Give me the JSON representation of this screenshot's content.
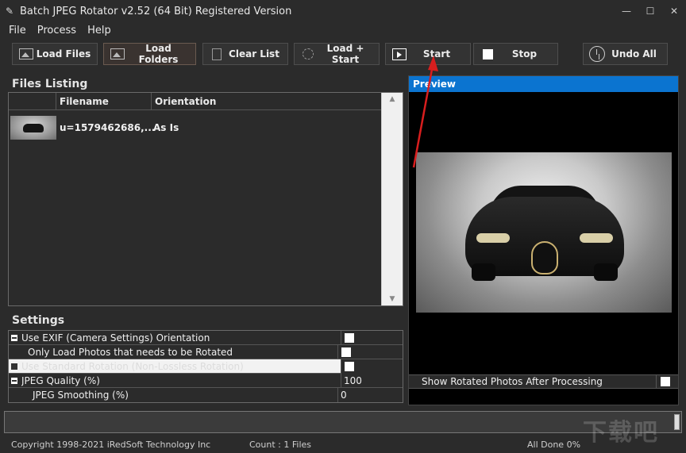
{
  "window": {
    "title": "Batch JPEG Rotator v2.52 (64 Bit) Registered Version",
    "app_icon": "app-logo-icon",
    "controls": [
      "minimize-icon",
      "maximize-icon",
      "close-icon"
    ]
  },
  "menu": [
    "File",
    "Process",
    "Help"
  ],
  "toolbar": {
    "load_files": "Load Files",
    "load_folders": "Load Folders",
    "clear_list": "Clear List",
    "load_start": "Load + Start",
    "start": "Start",
    "stop": "Stop",
    "undo_all": "Undo All"
  },
  "files": {
    "title": "Files Listing",
    "columns": [
      "Filename",
      "Orientation"
    ],
    "rows": [
      {
        "filename": "u=1579462686,...",
        "orientation": "As Is"
      }
    ]
  },
  "settings": {
    "title": "Settings",
    "rows": [
      {
        "label": "Use EXIF (Camera Settings) Orientation",
        "value": "",
        "checked": false
      },
      {
        "label": "Only Load Photos that needs to be Rotated",
        "value": "",
        "checked": false
      },
      {
        "label": "Use Standard Rotation (Non-Lossless Rotation)",
        "value": "",
        "checked": false
      },
      {
        "label": "JPEG Quality (%)",
        "value": "100"
      },
      {
        "label": "JPEG Smoothing (%)",
        "value": "0"
      }
    ]
  },
  "preview": {
    "title": "Preview",
    "show_rotated_label": "Show Rotated Photos After Processing",
    "show_rotated_checked": false
  },
  "progress": {
    "fraction": 0.0
  },
  "status": {
    "copyright": "Copyright 1998-2021 iRedSoft Technology Inc",
    "count": "Count : 1 Files",
    "done": "All Done",
    "percent": "0%"
  },
  "colors": {
    "accent": "#0b74d0",
    "annotation_arrow": "#d81e1e",
    "background": "#2b2b2b"
  },
  "watermark": "下载吧"
}
